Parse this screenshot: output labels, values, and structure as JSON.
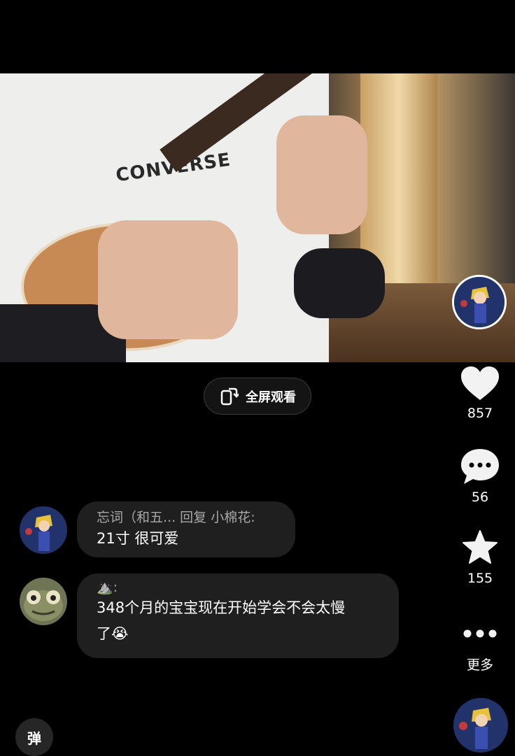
{
  "video": {
    "caption_logo": "CONVERSE"
  },
  "fullscreen": {
    "label": "全屏观看",
    "icon": "rotate-phone-icon"
  },
  "actions": {
    "like": {
      "icon": "heart-icon",
      "count": "857"
    },
    "comment": {
      "icon": "comment-bubble-icon",
      "count": "56"
    },
    "favorite": {
      "icon": "star-icon",
      "count": "155"
    },
    "more": {
      "icon": "more-dots-icon",
      "label": "更多"
    }
  },
  "comments": [
    {
      "author_prefix": "忘词（和五...",
      "reply_word": "回复",
      "reply_to": "小棉花:",
      "text": "21寸 很可爱"
    },
    {
      "author": "⛰️:",
      "text_line1": "348个月的宝宝现在开始学会不会太慢",
      "text_line2": "了😭"
    }
  ],
  "danmaku": {
    "label": "弹"
  },
  "colors": {
    "background": "#000000",
    "bubble": "#1f1f1f",
    "meta_text": "#a8a8a8"
  }
}
